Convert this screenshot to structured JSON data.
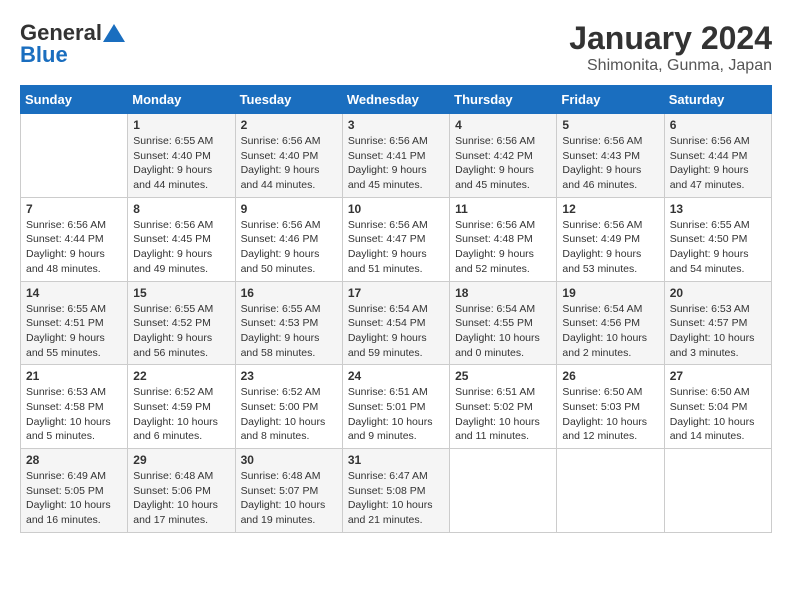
{
  "header": {
    "logo_line1": "General",
    "logo_line2": "Blue",
    "month": "January 2024",
    "location": "Shimonita, Gunma, Japan"
  },
  "days_of_week": [
    "Sunday",
    "Monday",
    "Tuesday",
    "Wednesday",
    "Thursday",
    "Friday",
    "Saturday"
  ],
  "weeks": [
    [
      {
        "day": "",
        "info": ""
      },
      {
        "day": "1",
        "info": "Sunrise: 6:55 AM\nSunset: 4:40 PM\nDaylight: 9 hours\nand 44 minutes."
      },
      {
        "day": "2",
        "info": "Sunrise: 6:56 AM\nSunset: 4:40 PM\nDaylight: 9 hours\nand 44 minutes."
      },
      {
        "day": "3",
        "info": "Sunrise: 6:56 AM\nSunset: 4:41 PM\nDaylight: 9 hours\nand 45 minutes."
      },
      {
        "day": "4",
        "info": "Sunrise: 6:56 AM\nSunset: 4:42 PM\nDaylight: 9 hours\nand 45 minutes."
      },
      {
        "day": "5",
        "info": "Sunrise: 6:56 AM\nSunset: 4:43 PM\nDaylight: 9 hours\nand 46 minutes."
      },
      {
        "day": "6",
        "info": "Sunrise: 6:56 AM\nSunset: 4:44 PM\nDaylight: 9 hours\nand 47 minutes."
      }
    ],
    [
      {
        "day": "7",
        "info": "Sunrise: 6:56 AM\nSunset: 4:44 PM\nDaylight: 9 hours\nand 48 minutes."
      },
      {
        "day": "8",
        "info": "Sunrise: 6:56 AM\nSunset: 4:45 PM\nDaylight: 9 hours\nand 49 minutes."
      },
      {
        "day": "9",
        "info": "Sunrise: 6:56 AM\nSunset: 4:46 PM\nDaylight: 9 hours\nand 50 minutes."
      },
      {
        "day": "10",
        "info": "Sunrise: 6:56 AM\nSunset: 4:47 PM\nDaylight: 9 hours\nand 51 minutes."
      },
      {
        "day": "11",
        "info": "Sunrise: 6:56 AM\nSunset: 4:48 PM\nDaylight: 9 hours\nand 52 minutes."
      },
      {
        "day": "12",
        "info": "Sunrise: 6:56 AM\nSunset: 4:49 PM\nDaylight: 9 hours\nand 53 minutes."
      },
      {
        "day": "13",
        "info": "Sunrise: 6:55 AM\nSunset: 4:50 PM\nDaylight: 9 hours\nand 54 minutes."
      }
    ],
    [
      {
        "day": "14",
        "info": "Sunrise: 6:55 AM\nSunset: 4:51 PM\nDaylight: 9 hours\nand 55 minutes."
      },
      {
        "day": "15",
        "info": "Sunrise: 6:55 AM\nSunset: 4:52 PM\nDaylight: 9 hours\nand 56 minutes."
      },
      {
        "day": "16",
        "info": "Sunrise: 6:55 AM\nSunset: 4:53 PM\nDaylight: 9 hours\nand 58 minutes."
      },
      {
        "day": "17",
        "info": "Sunrise: 6:54 AM\nSunset: 4:54 PM\nDaylight: 9 hours\nand 59 minutes."
      },
      {
        "day": "18",
        "info": "Sunrise: 6:54 AM\nSunset: 4:55 PM\nDaylight: 10 hours\nand 0 minutes."
      },
      {
        "day": "19",
        "info": "Sunrise: 6:54 AM\nSunset: 4:56 PM\nDaylight: 10 hours\nand 2 minutes."
      },
      {
        "day": "20",
        "info": "Sunrise: 6:53 AM\nSunset: 4:57 PM\nDaylight: 10 hours\nand 3 minutes."
      }
    ],
    [
      {
        "day": "21",
        "info": "Sunrise: 6:53 AM\nSunset: 4:58 PM\nDaylight: 10 hours\nand 5 minutes."
      },
      {
        "day": "22",
        "info": "Sunrise: 6:52 AM\nSunset: 4:59 PM\nDaylight: 10 hours\nand 6 minutes."
      },
      {
        "day": "23",
        "info": "Sunrise: 6:52 AM\nSunset: 5:00 PM\nDaylight: 10 hours\nand 8 minutes."
      },
      {
        "day": "24",
        "info": "Sunrise: 6:51 AM\nSunset: 5:01 PM\nDaylight: 10 hours\nand 9 minutes."
      },
      {
        "day": "25",
        "info": "Sunrise: 6:51 AM\nSunset: 5:02 PM\nDaylight: 10 hours\nand 11 minutes."
      },
      {
        "day": "26",
        "info": "Sunrise: 6:50 AM\nSunset: 5:03 PM\nDaylight: 10 hours\nand 12 minutes."
      },
      {
        "day": "27",
        "info": "Sunrise: 6:50 AM\nSunset: 5:04 PM\nDaylight: 10 hours\nand 14 minutes."
      }
    ],
    [
      {
        "day": "28",
        "info": "Sunrise: 6:49 AM\nSunset: 5:05 PM\nDaylight: 10 hours\nand 16 minutes."
      },
      {
        "day": "29",
        "info": "Sunrise: 6:48 AM\nSunset: 5:06 PM\nDaylight: 10 hours\nand 17 minutes."
      },
      {
        "day": "30",
        "info": "Sunrise: 6:48 AM\nSunset: 5:07 PM\nDaylight: 10 hours\nand 19 minutes."
      },
      {
        "day": "31",
        "info": "Sunrise: 6:47 AM\nSunset: 5:08 PM\nDaylight: 10 hours\nand 21 minutes."
      },
      {
        "day": "",
        "info": ""
      },
      {
        "day": "",
        "info": ""
      },
      {
        "day": "",
        "info": ""
      }
    ]
  ]
}
